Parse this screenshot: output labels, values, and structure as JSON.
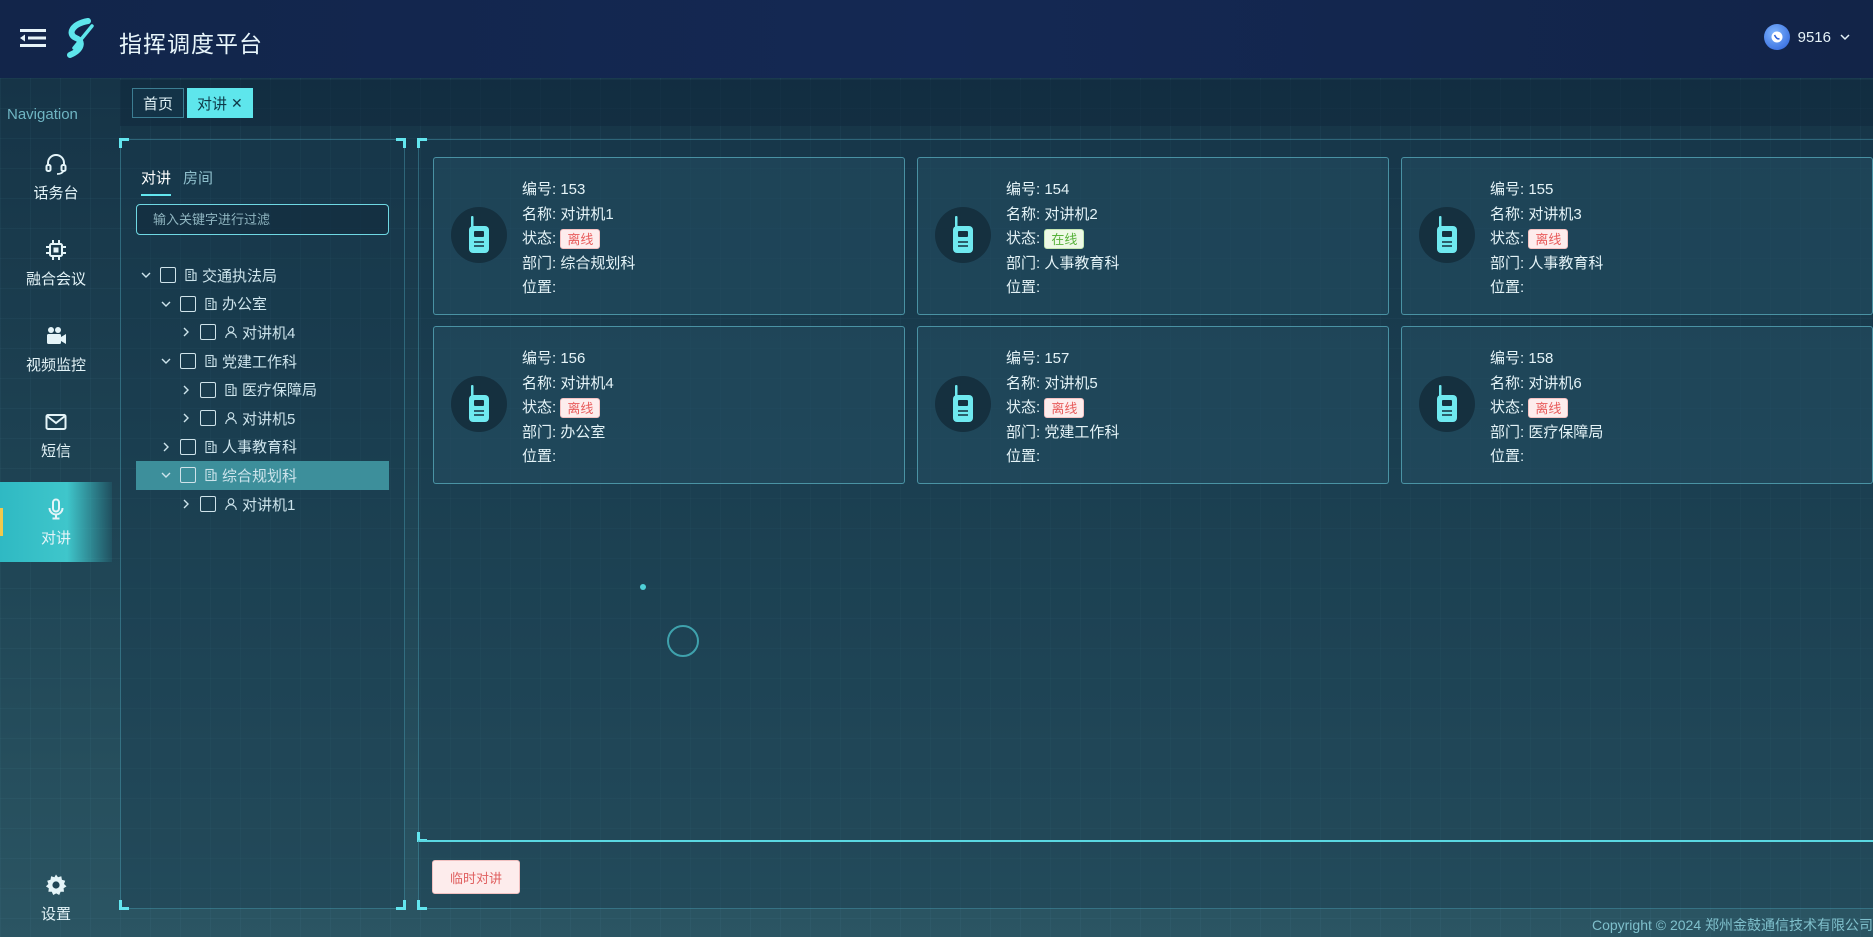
{
  "header": {
    "title": "指挥调度平台",
    "user_name": "9516",
    "icons": [
      "menu-toggle-icon",
      "logo-icon",
      "user-avatar-icon",
      "chevron-down-icon"
    ]
  },
  "nav": {
    "title": "Navigation",
    "items": [
      {
        "label": "话务台",
        "icon": "headset-icon"
      },
      {
        "label": "融合会议",
        "icon": "chip-icon"
      },
      {
        "label": "视频监控",
        "icon": "video-camera-icon"
      },
      {
        "label": "短信",
        "icon": "mail-icon"
      },
      {
        "label": "对讲",
        "icon": "microphone-icon",
        "active": true
      }
    ],
    "settings": {
      "label": "设置",
      "icon": "gear-icon"
    }
  },
  "tabs": {
    "home": "首页",
    "active": "对讲",
    "close_glyph": "✕"
  },
  "tree_panel": {
    "sub_tabs": [
      "对讲",
      "房间"
    ],
    "active_sub_tab": "对讲",
    "filter_placeholder": "输入关键字进行过滤",
    "nodes": [
      {
        "label": "交通执法局",
        "type": "dept",
        "level": 0,
        "expanded": true
      },
      {
        "label": "办公室",
        "type": "dept",
        "level": 1,
        "expanded": true
      },
      {
        "label": "对讲机4",
        "type": "user",
        "level": 2,
        "expanded": false
      },
      {
        "label": "党建工作科",
        "type": "dept",
        "level": 1,
        "expanded": true
      },
      {
        "label": "医疗保障局",
        "type": "dept",
        "level": 2,
        "expanded": false
      },
      {
        "label": "对讲机5",
        "type": "user",
        "level": 2,
        "expanded": false
      },
      {
        "label": "人事教育科",
        "type": "dept",
        "level": 1,
        "expanded": false
      },
      {
        "label": "综合规划科",
        "type": "dept",
        "level": 1,
        "expanded": true,
        "selected": true
      },
      {
        "label": "对讲机1",
        "type": "user",
        "level": 2,
        "expanded": false
      }
    ]
  },
  "labels": {
    "id": "编号:",
    "name": "名称:",
    "status": "状态:",
    "dept": "部门:",
    "location": "位置:"
  },
  "devices": [
    {
      "id": "153",
      "name": "对讲机1",
      "status": "离线",
      "online": false,
      "dept": "综合规划科",
      "location": ""
    },
    {
      "id": "154",
      "name": "对讲机2",
      "status": "在线",
      "online": true,
      "dept": "人事教育科",
      "location": ""
    },
    {
      "id": "155",
      "name": "对讲机3",
      "status": "离线",
      "online": false,
      "dept": "人事教育科",
      "location": ""
    },
    {
      "id": "156",
      "name": "对讲机4",
      "status": "离线",
      "online": false,
      "dept": "办公室",
      "location": ""
    },
    {
      "id": "157",
      "name": "对讲机5",
      "status": "离线",
      "online": false,
      "dept": "党建工作科",
      "location": ""
    },
    {
      "id": "158",
      "name": "对讲机6",
      "status": "离线",
      "online": false,
      "dept": "医疗保障局",
      "location": ""
    }
  ],
  "actions": {
    "temp_talk": "临时对讲"
  },
  "footer": {
    "copyright": "Copyright © 2024 郑州金鼓通信技术有限公司"
  },
  "colors": {
    "accent": "#5ee6ec",
    "header_bg": "#132750",
    "offline": "#e85c5c",
    "online": "#58b23b"
  }
}
